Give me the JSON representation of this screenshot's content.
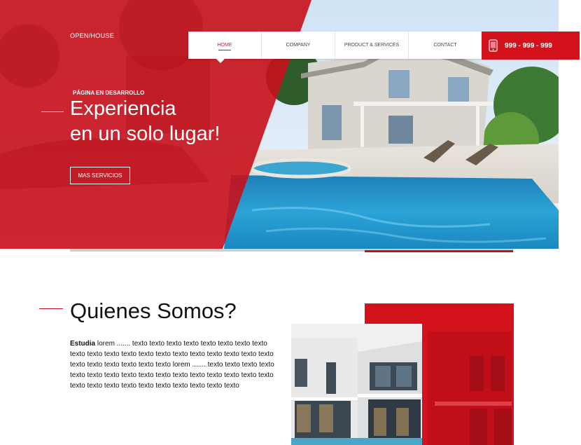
{
  "brand": "OPEN/HOUSE",
  "nav": {
    "items": [
      {
        "label": "HOME",
        "active": true
      },
      {
        "label": "COMPANY",
        "active": false
      },
      {
        "label": "PRODUCT & SERVICES",
        "active": false
      },
      {
        "label": "CONTACT",
        "active": false
      }
    ],
    "phone": "999 - 999 - 999",
    "phone_icon": "mobile-phone-icon"
  },
  "hero": {
    "eyebrow": "PÁGINA EN DESARROLLO",
    "headline_line1": "Experiencia",
    "headline_line2": "en un solo lugar!",
    "cta_label": "MAS SERVICIOS"
  },
  "about": {
    "title": "Quienes Somos?",
    "lead": "Estudia",
    "body": " lorem ....... texto texto texto texto texto texto texto texto texto texto texto texto texto texto texto texto texto texto texto texto texto texto texto texto texto texto lorem ....... texto texto texto texto texto texto texto texto texto texto texto texto texto texto texto texto texto texto texto texto texto texto texto texto texto texto"
  },
  "colors": {
    "accent": "#d4121c",
    "overlay": "#c8101a",
    "text": "#111111"
  }
}
